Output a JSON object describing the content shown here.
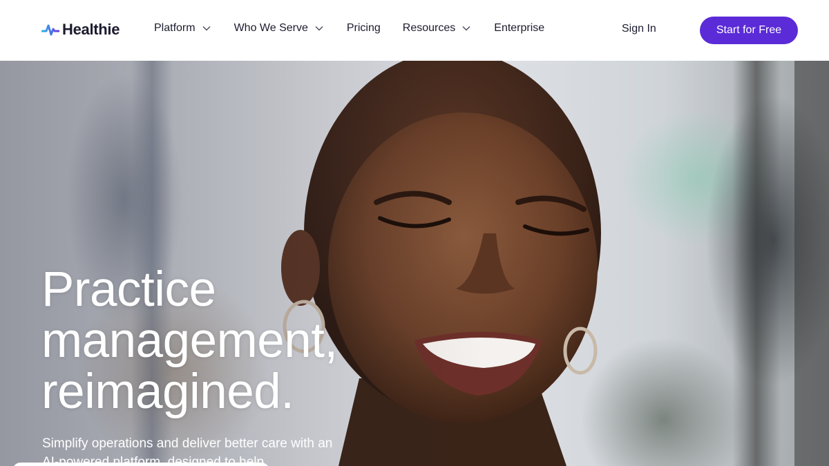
{
  "header": {
    "logo_text": "Healthie",
    "nav": [
      {
        "label": "Platform",
        "has_dropdown": true
      },
      {
        "label": "Who We Serve",
        "has_dropdown": true
      },
      {
        "label": "Pricing",
        "has_dropdown": false
      },
      {
        "label": "Resources",
        "has_dropdown": true
      },
      {
        "label": "Enterprise",
        "has_dropdown": false
      }
    ],
    "sign_in": "Sign In",
    "cta": "Start for Free"
  },
  "hero": {
    "headline_lines": [
      "Practice",
      "management,",
      "reimagined."
    ],
    "subtext": "Simplify operations and deliver better care with an AI-powered platform, designed to help"
  },
  "colors": {
    "brand": "#5b2bd8",
    "text": "#1c1b2e",
    "logo_gradient": [
      "#2fb5e8",
      "#6a3ae0"
    ]
  },
  "icons": [
    "healthie-logo-icon",
    "chevron-down-icon"
  ]
}
